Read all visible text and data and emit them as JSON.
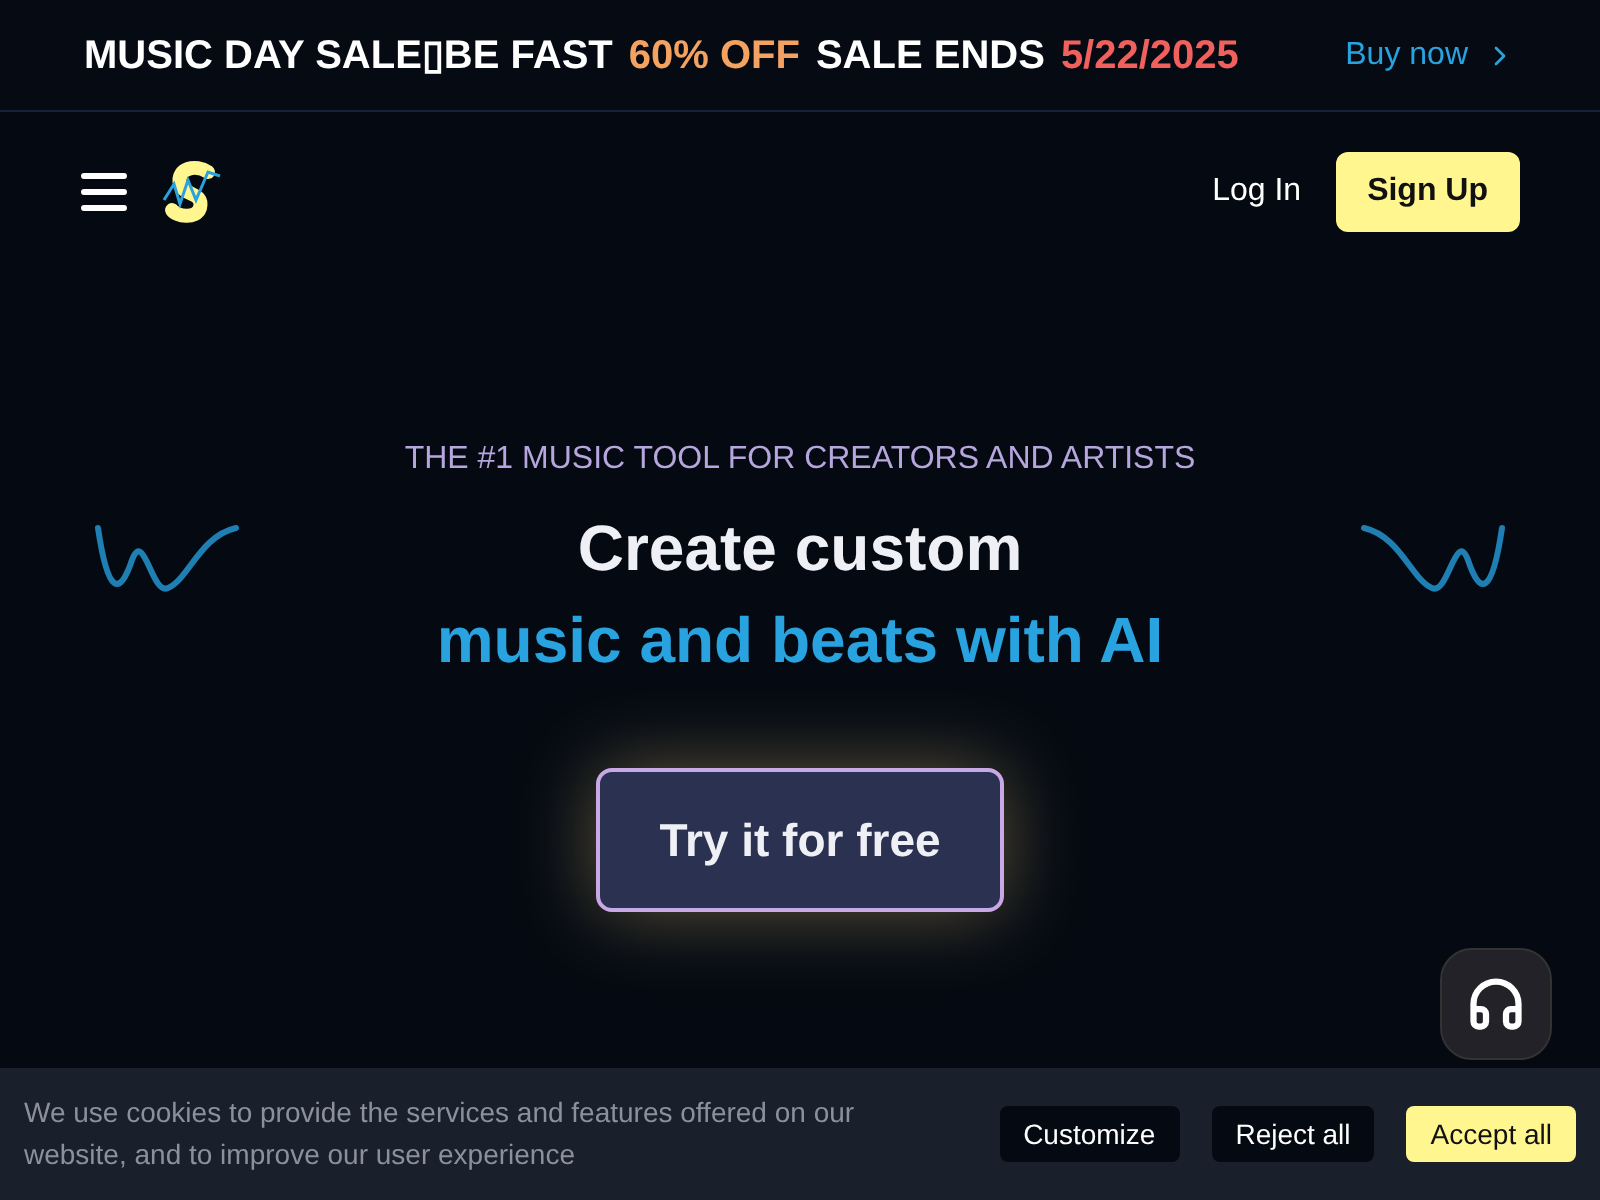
{
  "promo_bar": {
    "segments": [
      {
        "text": "MUSIC DAY SALE▯BE FAST",
        "color": "#ffffff"
      },
      {
        "text": "60% OFF",
        "color": "#f4a261"
      },
      {
        "text": "SALE ENDS",
        "color": "#ffffff"
      },
      {
        "text": "5/22/2025",
        "color": "#f0605d"
      }
    ],
    "link": "Buy now"
  },
  "nav": {
    "login": "Log In",
    "signup": "Sign Up"
  },
  "hero": {
    "eyebrow": "THE #1 MUSIC TOOL FOR CREATORS AND ARTISTS",
    "title_line_1": "Create custom",
    "title_line_2": "music and beats with AI",
    "cta": "Try it for free"
  },
  "cookie_banner": {
    "message": "We use cookies to provide the services and features offered on our website, and to improve our user experience",
    "buttons": [
      {
        "label": "Customize",
        "kind": "dark"
      },
      {
        "label": "Reject all",
        "kind": "dark"
      },
      {
        "label": "Accept all",
        "kind": "primary"
      }
    ]
  }
}
